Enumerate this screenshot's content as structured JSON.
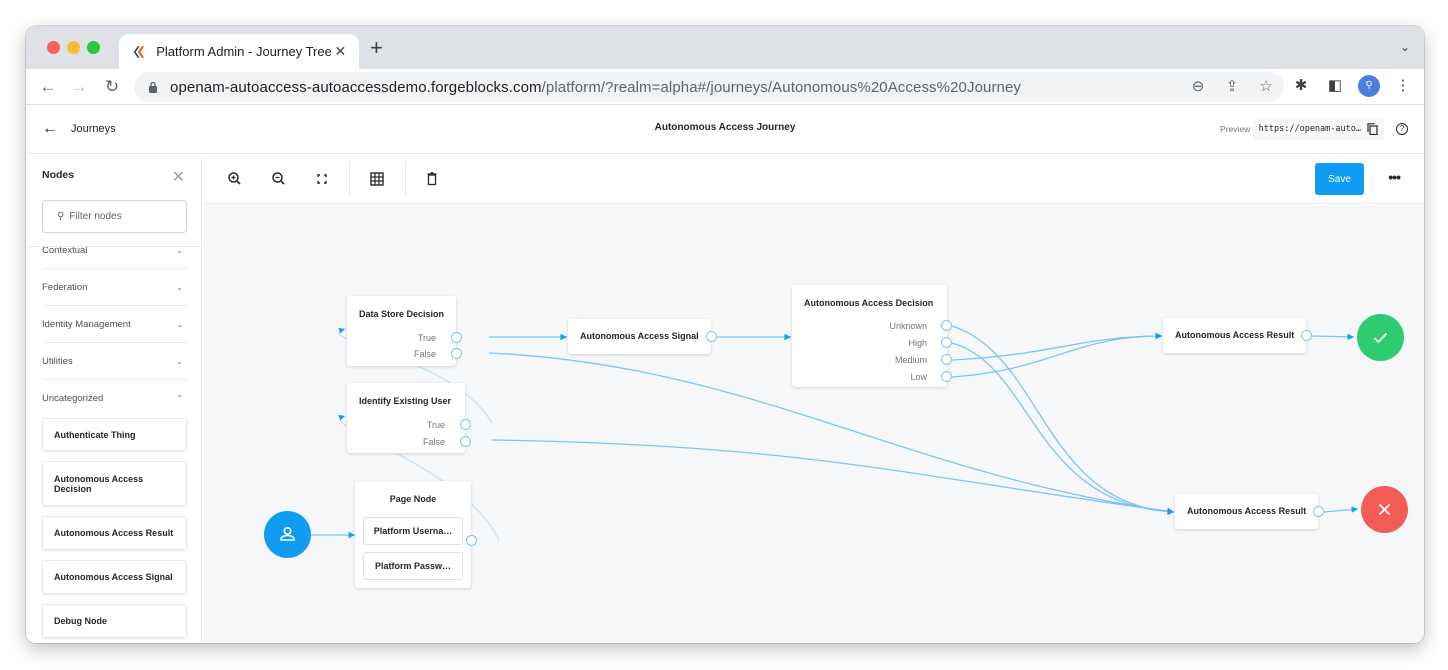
{
  "browser": {
    "tab_title": "Platform Admin - Journey Tree",
    "url_host": "openam-autoaccess-autoaccessdemo.forgeblocks.com",
    "url_rest": "/platform/?realm=alpha#/journeys/Autonomous%20Access%20Journey",
    "icons": [
      "back-icon",
      "forward-icon",
      "reload-icon",
      "lock-icon",
      "zoom-out-icon",
      "share-icon",
      "star-icon",
      "extensions-icon",
      "side-panel-icon",
      "profile-avatar",
      "kebab-menu-icon"
    ]
  },
  "header": {
    "back_label": "Journeys",
    "title": "Autonomous Access Journey",
    "preview_label": "Preview URL:",
    "preview_url": "https://openam-auto…"
  },
  "sidebar": {
    "title": "Nodes",
    "filter_placeholder": "Filter nodes",
    "categories": [
      {
        "label": "Contextual",
        "expanded": false
      },
      {
        "label": "Federation",
        "expanded": false
      },
      {
        "label": "Identity Management",
        "expanded": false
      },
      {
        "label": "Utilities",
        "expanded": false
      },
      {
        "label": "Uncategorized",
        "expanded": true
      }
    ],
    "items": [
      "Authenticate Thing",
      "Autonomous Access Decision",
      "Autonomous Access Result",
      "Autonomous Access Signal",
      "Debug Node"
    ]
  },
  "toolbar": {
    "tools": [
      "zoom-in",
      "zoom-out",
      "fit-to-screen",
      "grid",
      "delete"
    ],
    "save_label": "Save",
    "more_label": "•••"
  },
  "colors": {
    "accent": "#109cf1",
    "success": "#2ecc71",
    "failure": "#f25c54",
    "edge": "#7cc4f5",
    "canvas": "#f6f7f9"
  },
  "journey": {
    "nodes": {
      "data_store": {
        "title": "Data Store Decision",
        "outcomes": [
          "True",
          "False"
        ]
      },
      "identify_user": {
        "title": "Identify Existing User",
        "outcomes": [
          "True",
          "False"
        ]
      },
      "page_node": {
        "title": "Page Node",
        "children": [
          "Platform Userna…",
          "Platform Passw…"
        ]
      },
      "signal": {
        "title": "Autonomous Access Signal"
      },
      "decision": {
        "title": "Autonomous Access Decision",
        "outcomes": [
          "Unknown",
          "High",
          "Medium",
          "Low"
        ]
      },
      "result_success": {
        "title": "Autonomous Access Result"
      },
      "result_failure": {
        "title": "Autonomous Access Result"
      }
    },
    "connections": [
      {
        "from": "start",
        "to": "page_node"
      },
      {
        "from": "page_node",
        "to": "identify_user"
      },
      {
        "from": "identify_user.True",
        "to": "data_store"
      },
      {
        "from": "identify_user.False",
        "to": "result_failure"
      },
      {
        "from": "data_store.True",
        "to": "signal"
      },
      {
        "from": "data_store.False",
        "to": "result_failure"
      },
      {
        "from": "signal",
        "to": "decision"
      },
      {
        "from": "decision.Unknown",
        "to": "result_failure"
      },
      {
        "from": "decision.High",
        "to": "result_failure"
      },
      {
        "from": "decision.Medium",
        "to": "result_success"
      },
      {
        "from": "decision.Low",
        "to": "result_success"
      },
      {
        "from": "result_success",
        "to": "success"
      },
      {
        "from": "result_failure",
        "to": "failure"
      }
    ]
  }
}
